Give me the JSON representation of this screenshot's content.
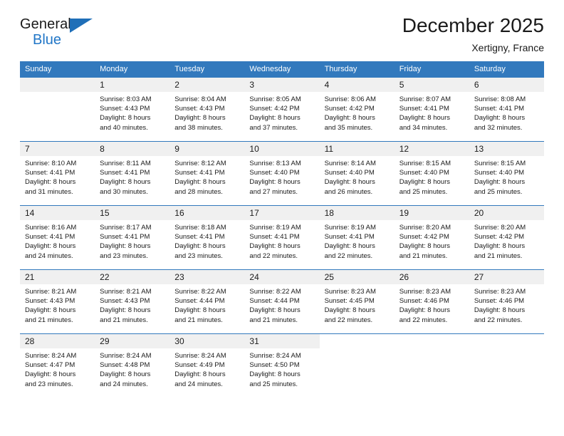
{
  "brand": {
    "line1": "General",
    "line2": "Blue",
    "accent_color": "#2176c7",
    "triangle_color": "#1f6fb8"
  },
  "header": {
    "title": "December 2025",
    "subtitle": "Xertigny, France"
  },
  "theme": {
    "header_bar": "#3279bd",
    "daynum_band": "#f0f0f0",
    "text": "#1a1a1a"
  },
  "weekday_headers": [
    "Sunday",
    "Monday",
    "Tuesday",
    "Wednesday",
    "Thursday",
    "Friday",
    "Saturday"
  ],
  "weeks": [
    [
      {
        "day": "",
        "sunrise": "",
        "sunset": "",
        "daylight1": "",
        "daylight2": "",
        "blank": true
      },
      {
        "day": "1",
        "sunrise": "Sunrise: 8:03 AM",
        "sunset": "Sunset: 4:43 PM",
        "daylight1": "Daylight: 8 hours",
        "daylight2": "and 40 minutes."
      },
      {
        "day": "2",
        "sunrise": "Sunrise: 8:04 AM",
        "sunset": "Sunset: 4:43 PM",
        "daylight1": "Daylight: 8 hours",
        "daylight2": "and 38 minutes."
      },
      {
        "day": "3",
        "sunrise": "Sunrise: 8:05 AM",
        "sunset": "Sunset: 4:42 PM",
        "daylight1": "Daylight: 8 hours",
        "daylight2": "and 37 minutes."
      },
      {
        "day": "4",
        "sunrise": "Sunrise: 8:06 AM",
        "sunset": "Sunset: 4:42 PM",
        "daylight1": "Daylight: 8 hours",
        "daylight2": "and 35 minutes."
      },
      {
        "day": "5",
        "sunrise": "Sunrise: 8:07 AM",
        "sunset": "Sunset: 4:41 PM",
        "daylight1": "Daylight: 8 hours",
        "daylight2": "and 34 minutes."
      },
      {
        "day": "6",
        "sunrise": "Sunrise: 8:08 AM",
        "sunset": "Sunset: 4:41 PM",
        "daylight1": "Daylight: 8 hours",
        "daylight2": "and 32 minutes."
      }
    ],
    [
      {
        "day": "7",
        "sunrise": "Sunrise: 8:10 AM",
        "sunset": "Sunset: 4:41 PM",
        "daylight1": "Daylight: 8 hours",
        "daylight2": "and 31 minutes."
      },
      {
        "day": "8",
        "sunrise": "Sunrise: 8:11 AM",
        "sunset": "Sunset: 4:41 PM",
        "daylight1": "Daylight: 8 hours",
        "daylight2": "and 30 minutes."
      },
      {
        "day": "9",
        "sunrise": "Sunrise: 8:12 AM",
        "sunset": "Sunset: 4:41 PM",
        "daylight1": "Daylight: 8 hours",
        "daylight2": "and 28 minutes."
      },
      {
        "day": "10",
        "sunrise": "Sunrise: 8:13 AM",
        "sunset": "Sunset: 4:40 PM",
        "daylight1": "Daylight: 8 hours",
        "daylight2": "and 27 minutes."
      },
      {
        "day": "11",
        "sunrise": "Sunrise: 8:14 AM",
        "sunset": "Sunset: 4:40 PM",
        "daylight1": "Daylight: 8 hours",
        "daylight2": "and 26 minutes."
      },
      {
        "day": "12",
        "sunrise": "Sunrise: 8:15 AM",
        "sunset": "Sunset: 4:40 PM",
        "daylight1": "Daylight: 8 hours",
        "daylight2": "and 25 minutes."
      },
      {
        "day": "13",
        "sunrise": "Sunrise: 8:15 AM",
        "sunset": "Sunset: 4:40 PM",
        "daylight1": "Daylight: 8 hours",
        "daylight2": "and 25 minutes."
      }
    ],
    [
      {
        "day": "14",
        "sunrise": "Sunrise: 8:16 AM",
        "sunset": "Sunset: 4:41 PM",
        "daylight1": "Daylight: 8 hours",
        "daylight2": "and 24 minutes."
      },
      {
        "day": "15",
        "sunrise": "Sunrise: 8:17 AM",
        "sunset": "Sunset: 4:41 PM",
        "daylight1": "Daylight: 8 hours",
        "daylight2": "and 23 minutes."
      },
      {
        "day": "16",
        "sunrise": "Sunrise: 8:18 AM",
        "sunset": "Sunset: 4:41 PM",
        "daylight1": "Daylight: 8 hours",
        "daylight2": "and 23 minutes."
      },
      {
        "day": "17",
        "sunrise": "Sunrise: 8:19 AM",
        "sunset": "Sunset: 4:41 PM",
        "daylight1": "Daylight: 8 hours",
        "daylight2": "and 22 minutes."
      },
      {
        "day": "18",
        "sunrise": "Sunrise: 8:19 AM",
        "sunset": "Sunset: 4:41 PM",
        "daylight1": "Daylight: 8 hours",
        "daylight2": "and 22 minutes."
      },
      {
        "day": "19",
        "sunrise": "Sunrise: 8:20 AM",
        "sunset": "Sunset: 4:42 PM",
        "daylight1": "Daylight: 8 hours",
        "daylight2": "and 21 minutes."
      },
      {
        "day": "20",
        "sunrise": "Sunrise: 8:20 AM",
        "sunset": "Sunset: 4:42 PM",
        "daylight1": "Daylight: 8 hours",
        "daylight2": "and 21 minutes."
      }
    ],
    [
      {
        "day": "21",
        "sunrise": "Sunrise: 8:21 AM",
        "sunset": "Sunset: 4:43 PM",
        "daylight1": "Daylight: 8 hours",
        "daylight2": "and 21 minutes."
      },
      {
        "day": "22",
        "sunrise": "Sunrise: 8:21 AM",
        "sunset": "Sunset: 4:43 PM",
        "daylight1": "Daylight: 8 hours",
        "daylight2": "and 21 minutes."
      },
      {
        "day": "23",
        "sunrise": "Sunrise: 8:22 AM",
        "sunset": "Sunset: 4:44 PM",
        "daylight1": "Daylight: 8 hours",
        "daylight2": "and 21 minutes."
      },
      {
        "day": "24",
        "sunrise": "Sunrise: 8:22 AM",
        "sunset": "Sunset: 4:44 PM",
        "daylight1": "Daylight: 8 hours",
        "daylight2": "and 21 minutes."
      },
      {
        "day": "25",
        "sunrise": "Sunrise: 8:23 AM",
        "sunset": "Sunset: 4:45 PM",
        "daylight1": "Daylight: 8 hours",
        "daylight2": "and 22 minutes."
      },
      {
        "day": "26",
        "sunrise": "Sunrise: 8:23 AM",
        "sunset": "Sunset: 4:46 PM",
        "daylight1": "Daylight: 8 hours",
        "daylight2": "and 22 minutes."
      },
      {
        "day": "27",
        "sunrise": "Sunrise: 8:23 AM",
        "sunset": "Sunset: 4:46 PM",
        "daylight1": "Daylight: 8 hours",
        "daylight2": "and 22 minutes."
      }
    ],
    [
      {
        "day": "28",
        "sunrise": "Sunrise: 8:24 AM",
        "sunset": "Sunset: 4:47 PM",
        "daylight1": "Daylight: 8 hours",
        "daylight2": "and 23 minutes."
      },
      {
        "day": "29",
        "sunrise": "Sunrise: 8:24 AM",
        "sunset": "Sunset: 4:48 PM",
        "daylight1": "Daylight: 8 hours",
        "daylight2": "and 24 minutes."
      },
      {
        "day": "30",
        "sunrise": "Sunrise: 8:24 AM",
        "sunset": "Sunset: 4:49 PM",
        "daylight1": "Daylight: 8 hours",
        "daylight2": "and 24 minutes."
      },
      {
        "day": "31",
        "sunrise": "Sunrise: 8:24 AM",
        "sunset": "Sunset: 4:50 PM",
        "daylight1": "Daylight: 8 hours",
        "daylight2": "and 25 minutes."
      },
      {
        "day": "",
        "sunrise": "",
        "sunset": "",
        "daylight1": "",
        "daylight2": "",
        "blank": true,
        "trailing": true
      },
      {
        "day": "",
        "sunrise": "",
        "sunset": "",
        "daylight1": "",
        "daylight2": "",
        "blank": true,
        "trailing": true
      },
      {
        "day": "",
        "sunrise": "",
        "sunset": "",
        "daylight1": "",
        "daylight2": "",
        "blank": true,
        "trailing": true
      }
    ]
  ]
}
